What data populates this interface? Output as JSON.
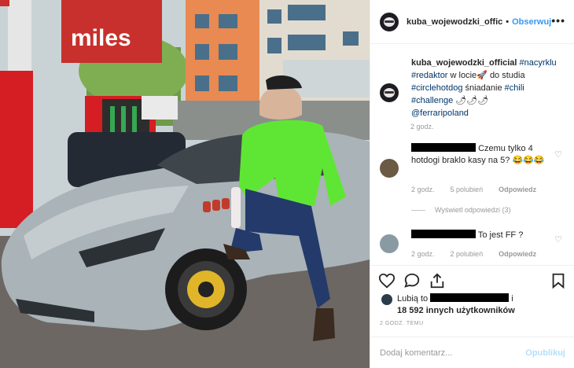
{
  "post": {
    "username": "kuba_wojewodzki_offic",
    "follow_label": "Obserwuj",
    "more_label": "•••"
  },
  "caption": {
    "username": "kuba_wojewodzki_official",
    "tag1": "#nacyrklu",
    "tag2": "#redaktor",
    "text1": "w locie",
    "emoji1": "🚀",
    "text2": "do studia",
    "tag3": "#circlehotdog",
    "text3": "śniadanie",
    "tag4": "#chili",
    "tag5": "#challenge",
    "emoji2": "🌶🌶🌶",
    "mention": "@ferraripoland",
    "time": "2 godz."
  },
  "comments": [
    {
      "text": "Czemu tylko 4 hotdogi braklo kasy na 5?",
      "emoji": "😂😂😂",
      "time": "2 godz.",
      "likes": "5 polubień",
      "reply": "Odpowiedz"
    },
    {
      "text": "To jest FF ?",
      "time": "2 godz.",
      "likes": "2 polubień",
      "reply": "Odpowiedz"
    }
  ],
  "thread": {
    "label": "Wyświetl odpowiedzi (3)"
  },
  "likes": {
    "prefix": "Lubią to",
    "conj": "i",
    "count": "18 592 innych użytkowników"
  },
  "date": "2 GODZ. TEMU",
  "composer": {
    "placeholder": "Dodaj komentarz...",
    "post_label": "Opublikuj"
  },
  "photo": {
    "station_brand": "miles",
    "colors": {
      "car": "#a9b3b8",
      "jacket": "#5fe634",
      "pump": "#d51d24"
    }
  },
  "icons": [
    "heart-icon",
    "comment-icon",
    "share-icon",
    "bookmark-icon",
    "more-icon"
  ]
}
